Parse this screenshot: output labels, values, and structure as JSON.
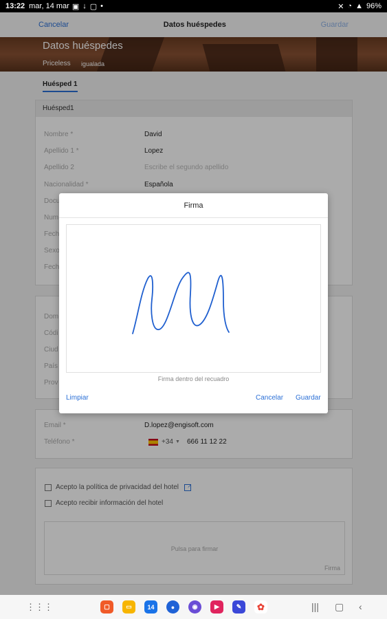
{
  "status_bar": {
    "time": "13:22",
    "date": "mar, 14 mar",
    "battery": "96%"
  },
  "topbar": {
    "cancel": "Cancelar",
    "title": "Datos huéspedes",
    "save": "Guardar"
  },
  "hero": {
    "title": "Datos huéspedes",
    "brand": "Priceless",
    "brand_sub": "igualada"
  },
  "tab": {
    "label": "Huésped 1"
  },
  "guest_card": {
    "header": "Huésped1",
    "fields": [
      {
        "label": "Nombre *",
        "value": "David"
      },
      {
        "label": "Apellido 1 *",
        "value": "Lopez"
      },
      {
        "label": "Apellido 2",
        "placeholder": "Escribe el segundo apellido"
      },
      {
        "label": "Nacionalidad *",
        "value": "Española"
      },
      {
        "label": "Docu"
      },
      {
        "label": "Num"
      },
      {
        "label": "Fech"
      },
      {
        "label": "Sexo"
      },
      {
        "label": "Fech"
      }
    ]
  },
  "address_card": {
    "fields": [
      {
        "label": "Dom"
      },
      {
        "label": "Códi"
      },
      {
        "label": "Ciud"
      },
      {
        "label": "País"
      },
      {
        "label": "Prov"
      }
    ]
  },
  "contact_card": {
    "email_label": "Email *",
    "email_value": "D.lopez@engisoft.com",
    "phone_label": "Teléfono *",
    "phone_prefix": "+34",
    "phone_value": "666 11 12 22"
  },
  "consent_card": {
    "privacy_label": "Acepto la política de privacidad del hotel",
    "info_label": "Acepto recibir información del hotel",
    "sign_hint": "Pulsa para firmar",
    "sign_sub": "Firma"
  },
  "signature_modal": {
    "title": "Firma",
    "hint": "Firma dentro del recuadro",
    "clear": "Limpiar",
    "cancel": "Cancelar",
    "save": "Guardar"
  },
  "colors": {
    "accent": "#2a6fd6"
  }
}
